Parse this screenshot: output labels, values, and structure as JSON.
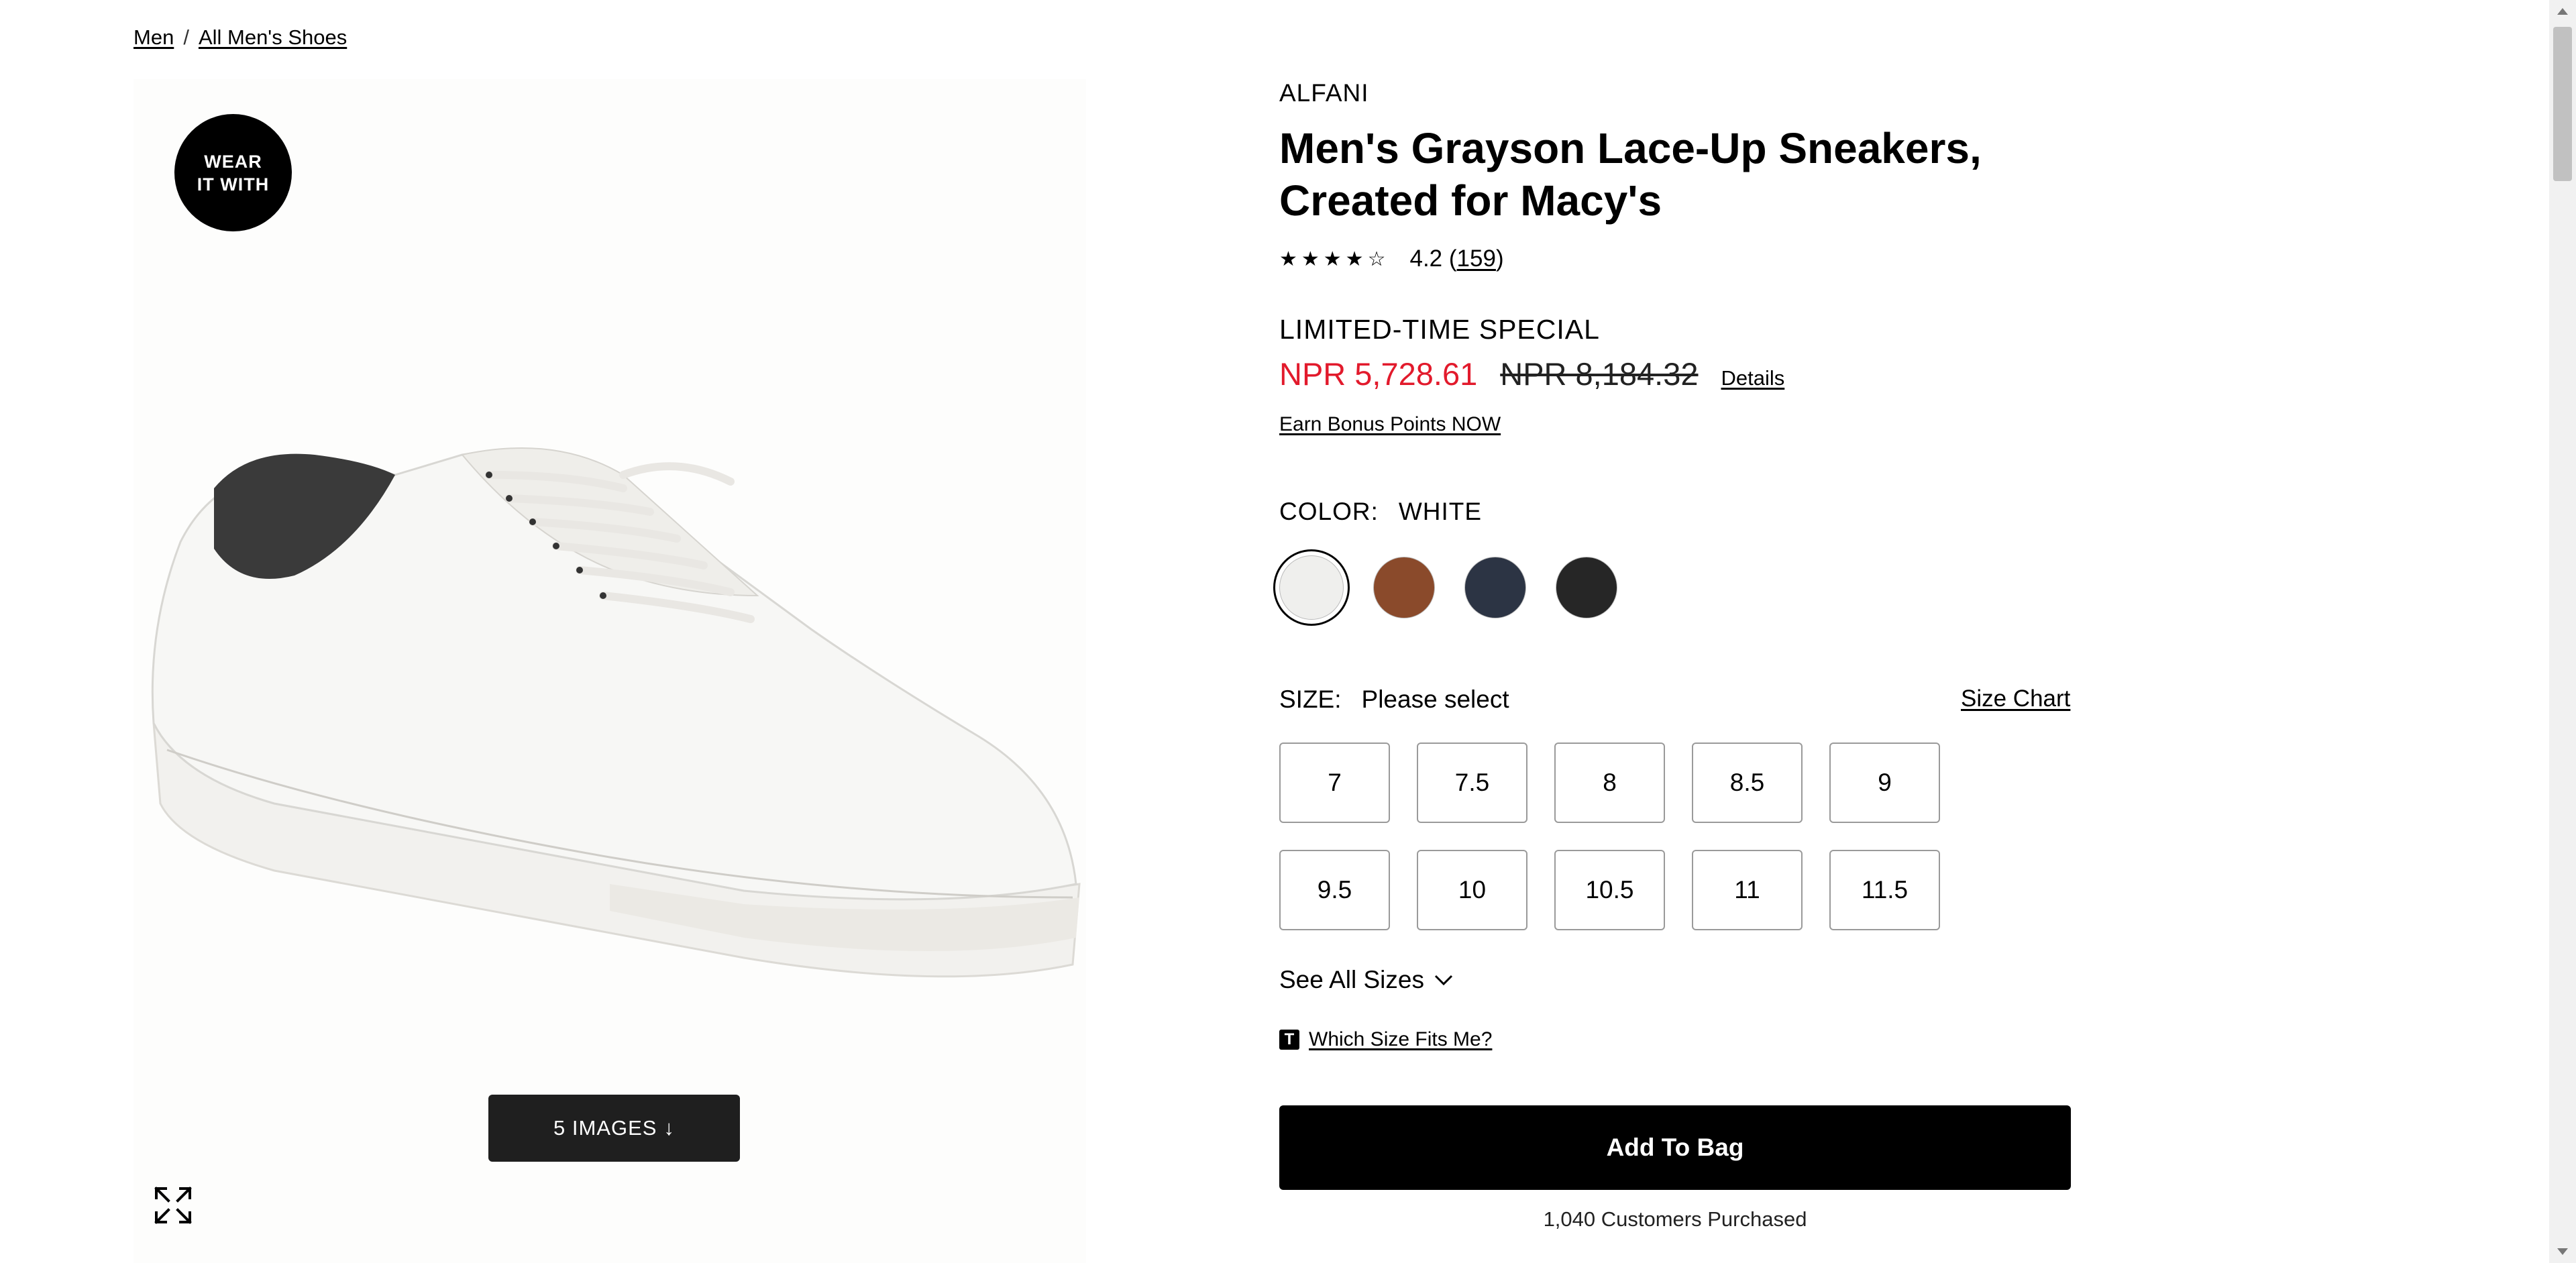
{
  "breadcrumb": {
    "items": [
      "Men",
      "All Men's Shoes"
    ],
    "separator": "/"
  },
  "gallery": {
    "badge_line1": "WEAR",
    "badge_line2": "IT WITH",
    "images_button_label": "5 IMAGES",
    "images_button_icon": "arrow-down-icon",
    "expand_icon": "expand-icon"
  },
  "product": {
    "brand": "ALFANI",
    "title": "Men's Grayson Lace-Up Sneakers, Created for Macy's",
    "rating": {
      "value": "4.2",
      "count": "159",
      "stars_filled": 4,
      "stars_total": 5
    },
    "promo_label": "LIMITED-TIME SPECIAL",
    "sale_price": "NPR 5,728.61",
    "original_price": "NPR 8,184.32",
    "details_label": "Details",
    "bonus_label": "Earn Bonus Points NOW"
  },
  "color": {
    "label": "COLOR:",
    "selected": "WHITE",
    "swatches": [
      {
        "name": "white",
        "hex": "#efefed",
        "selected": true
      },
      {
        "name": "brown",
        "hex": "#8a4a2b"
      },
      {
        "name": "navy",
        "hex": "#2c3444"
      },
      {
        "name": "black",
        "hex": "#262626"
      }
    ]
  },
  "size": {
    "label": "SIZE:",
    "prompt": "Please select",
    "chart_label": "Size Chart",
    "row1": [
      "7",
      "7.5",
      "8",
      "8.5",
      "9"
    ],
    "row2": [
      "9.5",
      "10",
      "10.5",
      "11",
      "11.5"
    ],
    "see_all_label": "See All Sizes",
    "fit_icon_letter": "T",
    "fit_label": "Which Size Fits Me?"
  },
  "actions": {
    "add_to_bag": "Add To Bag",
    "purchased": "1,040 Customers Purchased"
  },
  "colors": {
    "sale": "#e21a2c",
    "button_bg": "#000000",
    "images_button_bg": "#1f1f1f"
  }
}
